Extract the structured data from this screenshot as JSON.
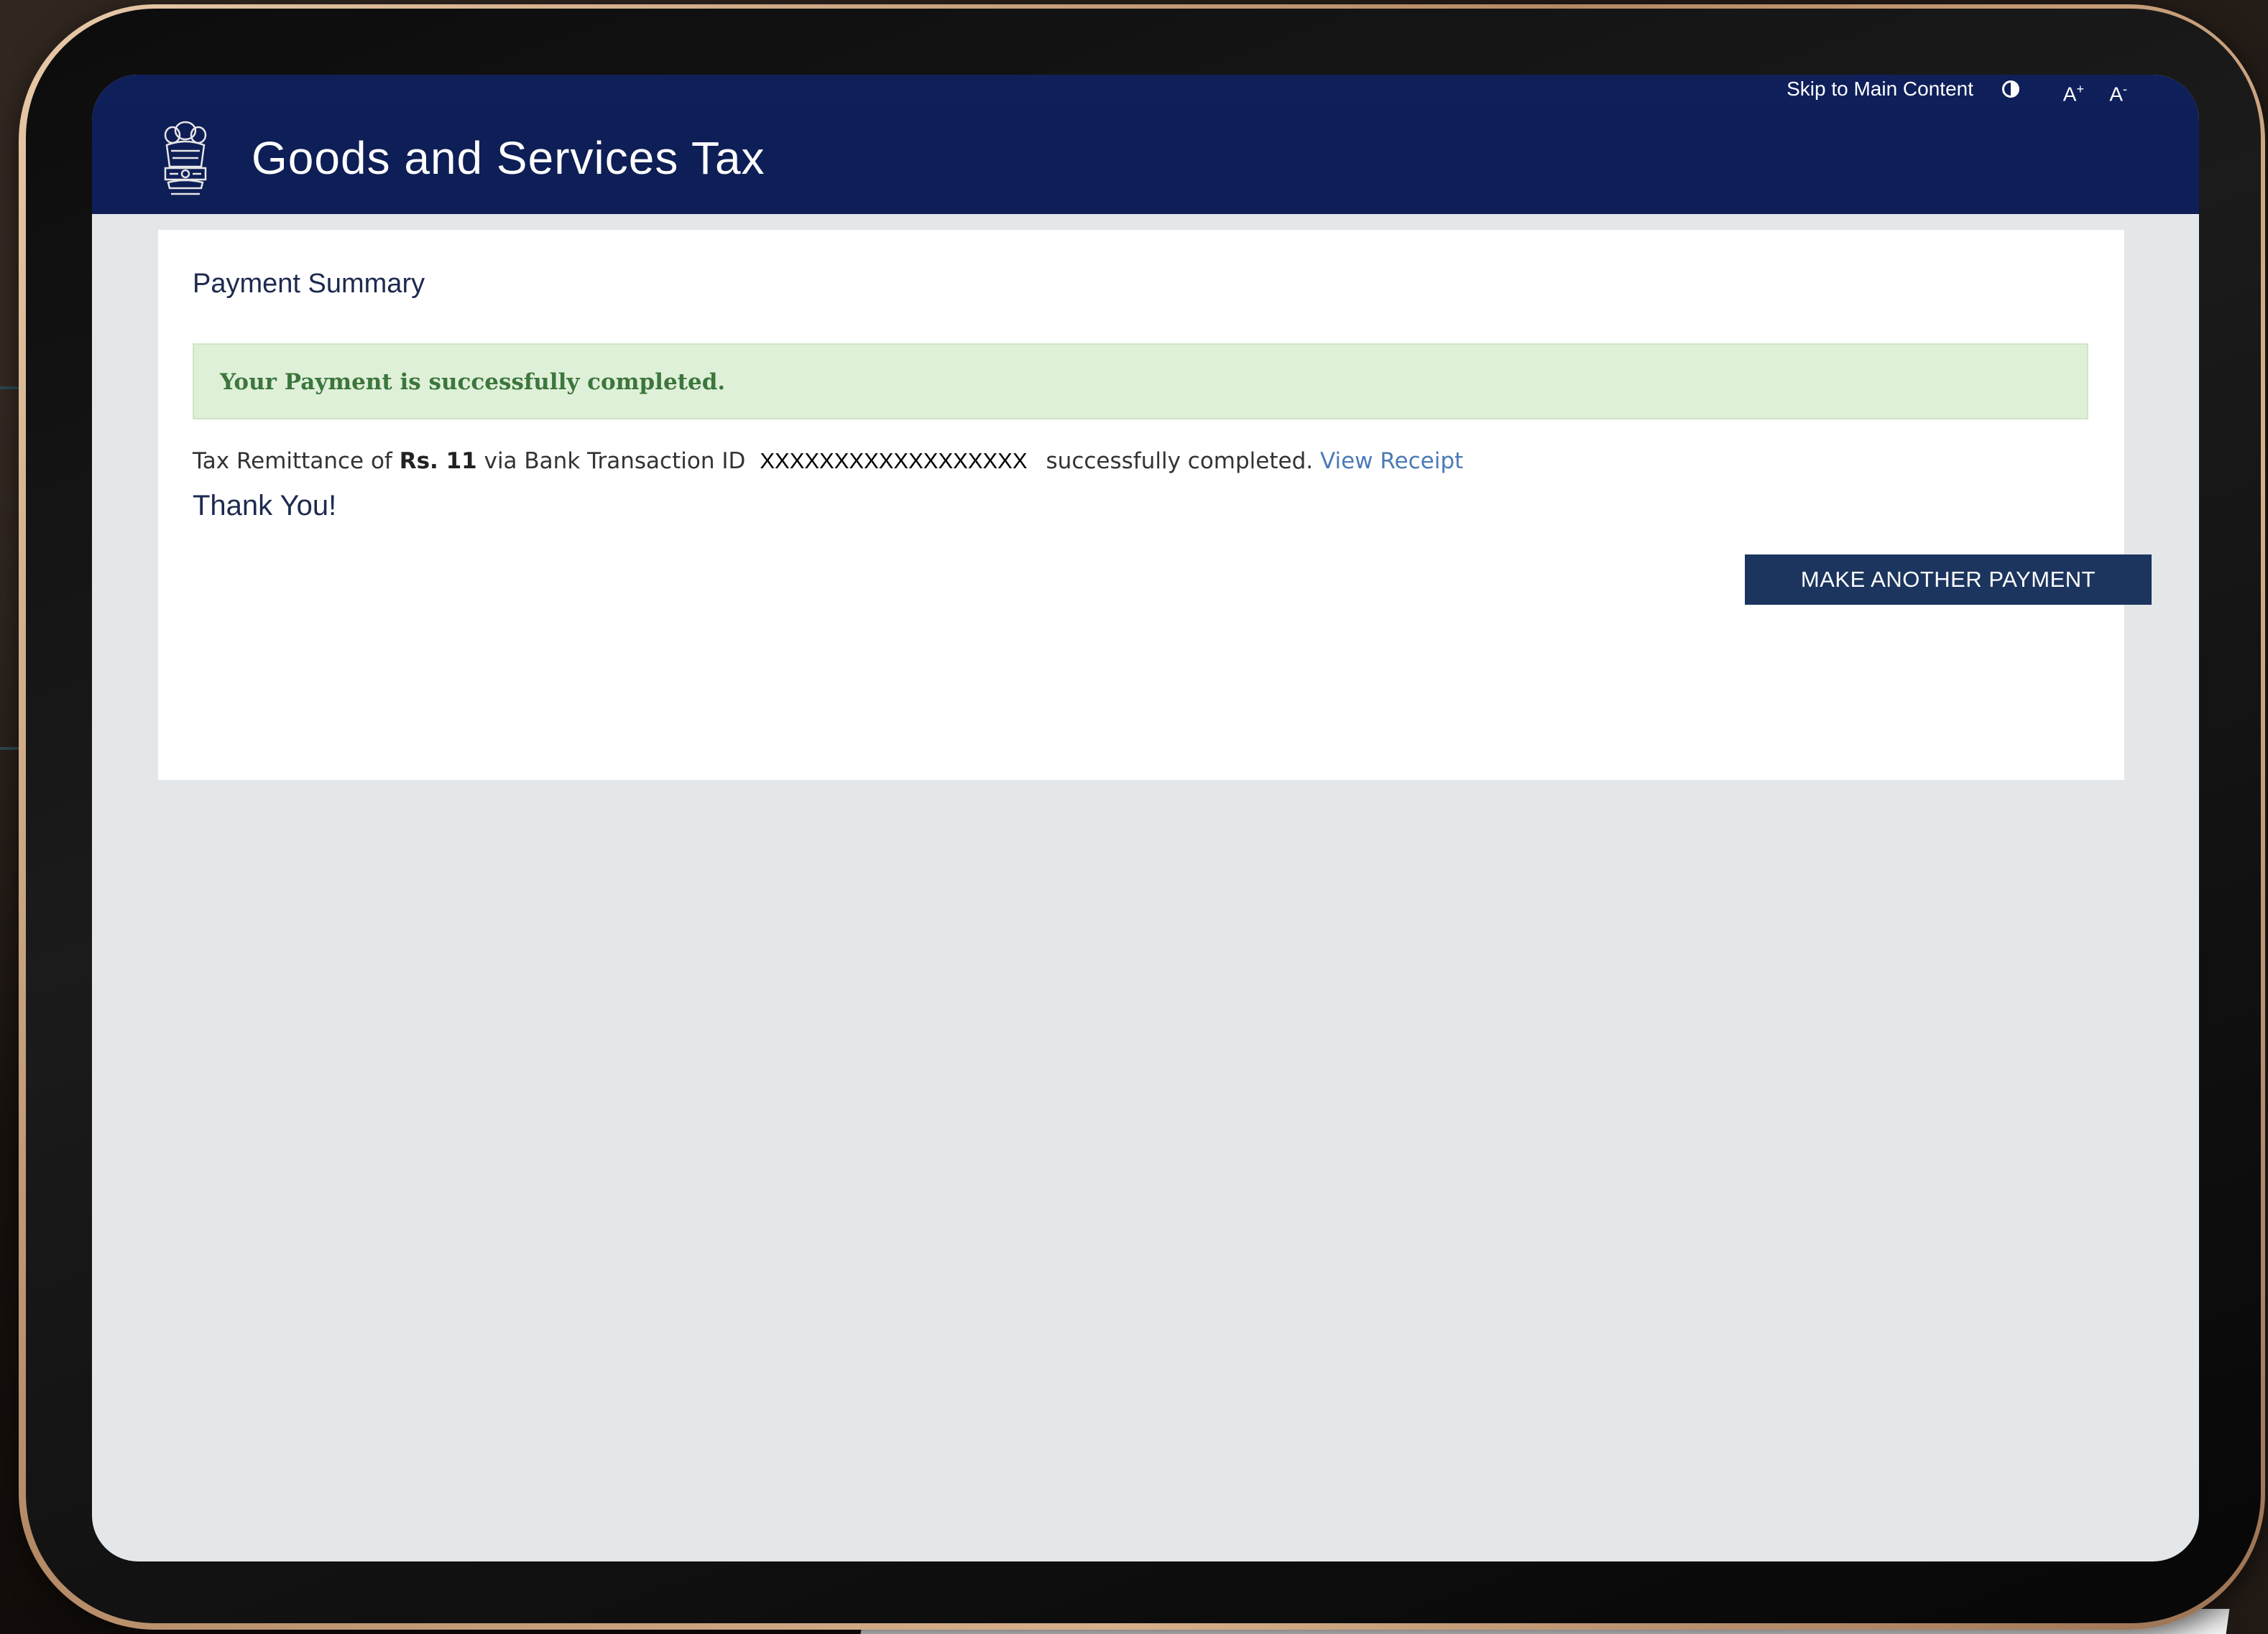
{
  "header": {
    "skip_link": "Skip to Main Content",
    "font_increase": "A",
    "font_increase_sup": "+",
    "font_decrease": "A",
    "font_decrease_sup": "-",
    "site_title": "Goods and Services Tax",
    "colors": {
      "header_bg": "#0e1e56"
    },
    "icons": [
      "contrast-icon",
      "emblem-icon"
    ]
  },
  "payment_summary": {
    "title": "Payment Summary",
    "alert_text": "Your Payment is successfully completed.",
    "remittance": {
      "prefix": "Tax Remittance of",
      "amount": "Rs. 11",
      "via_text": "via Bank Transaction ID",
      "transaction_id": "XXXXXXXXXXXXXXXXXX",
      "suffix": "successfully completed.",
      "link_label": "View Receipt"
    },
    "thanks": "Thank You!",
    "button_label": "MAKE ANOTHER PAYMENT",
    "colors": {
      "alert_bg": "#dff0d8",
      "alert_text": "#3c763d",
      "button_bg": "#1c355e",
      "link": "#4a7bb7"
    }
  }
}
